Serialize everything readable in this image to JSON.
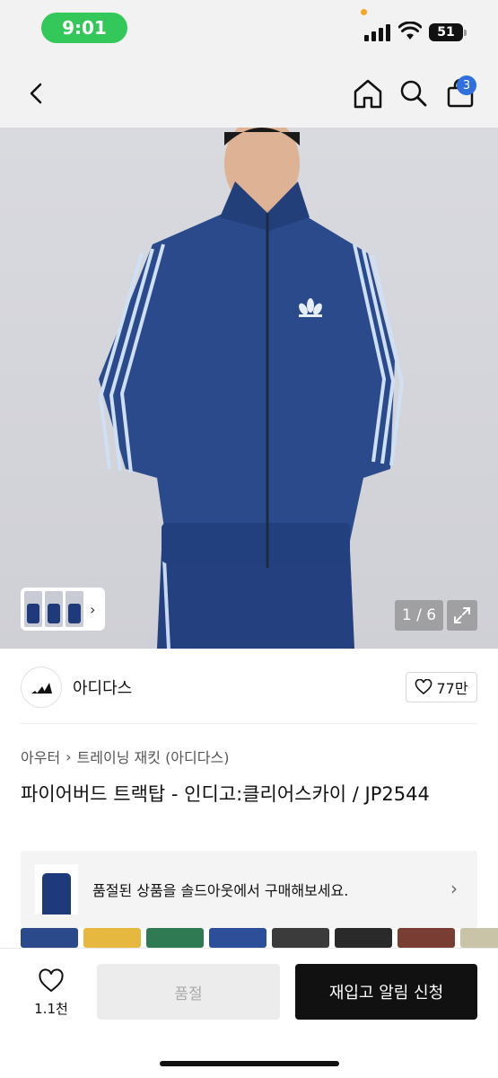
{
  "status_bar": {
    "time": "9:01",
    "battery": "51"
  },
  "nav": {
    "back_icon": "chevron-left-icon",
    "home_icon": "home-icon",
    "search_icon": "search-icon",
    "cart_icon": "shopping-bag-icon",
    "cart_count": "3"
  },
  "hero": {
    "image_counter": "1 / 6",
    "thumb_chevron": "›"
  },
  "brand": {
    "name": "아디다스",
    "like_count": "77만"
  },
  "breadcrumb": {
    "category": "아우터",
    "separator": "›",
    "subcategory": "트레이닝 재킷 (아디다스)"
  },
  "product": {
    "title": "파이어버드 트랙탑 - 인디고:클리어스카이 / JP2544"
  },
  "soldout_banner": {
    "text": "품절된 상품을 솔드아웃에서 구매해보세요.",
    "chevron": "›"
  },
  "swatch_colors": [
    "#2a4a8c",
    "#e6b840",
    "#2f7a52",
    "#2d4f99",
    "#3b3b3b",
    "#2a2a2a",
    "#7a3d33",
    "#c9c3a8"
  ],
  "bottom_bar": {
    "wish_count": "1.1천",
    "soldout_label": "품절",
    "restock_label": "재입고 알림 신청"
  },
  "colors": {
    "accent_badge": "#2f6fde",
    "status_pill": "#34c759"
  }
}
